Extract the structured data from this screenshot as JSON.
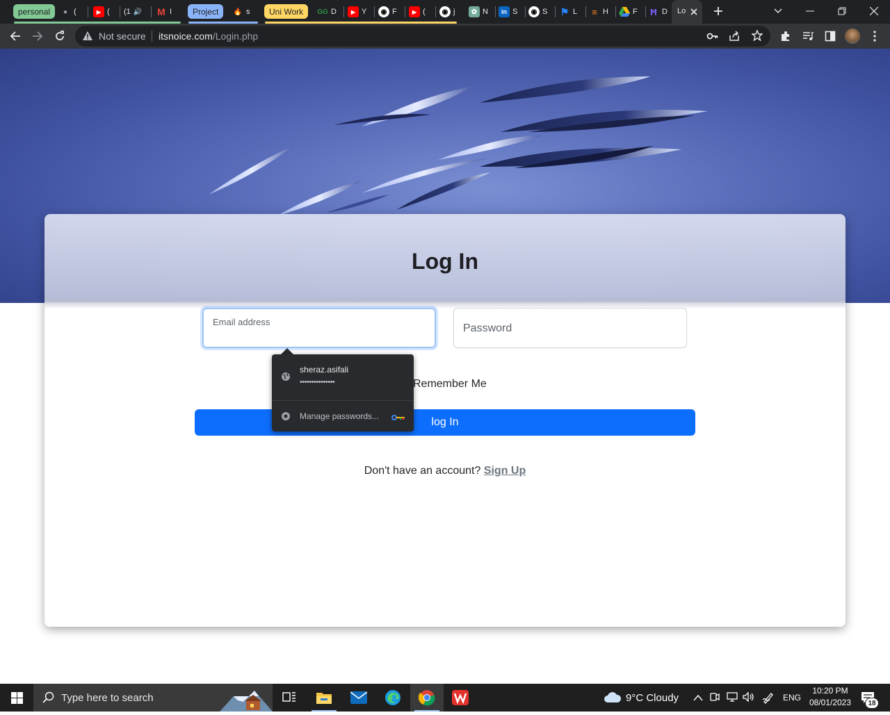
{
  "browser": {
    "tab_groups": [
      {
        "label": "personal",
        "color": "#81c995",
        "text_color": "#202124"
      },
      {
        "label": "Project",
        "color": "#8ab4f8",
        "text_color": "#202124"
      },
      {
        "label": "Uni Work",
        "color": "#fdd663",
        "text_color": "#202124"
      }
    ],
    "tabs": [
      {
        "title": "(",
        "icon": "generic"
      },
      {
        "title": "(",
        "icon": "youtube-icon"
      },
      {
        "title": "(1",
        "icon": "generic"
      },
      {
        "title": "I",
        "icon": "gmail-icon"
      },
      {
        "title": "s",
        "icon": "flame-icon"
      },
      {
        "title": "D",
        "icon": "geeks-icon"
      },
      {
        "title": "Y",
        "icon": "youtube-icon"
      },
      {
        "title": "F",
        "icon": "github-icon"
      },
      {
        "title": "(",
        "icon": "youtube-icon"
      },
      {
        "title": "j",
        "icon": "github-icon"
      },
      {
        "title": "N",
        "icon": "chatgpt-icon"
      },
      {
        "title": "S",
        "icon": "linkedin-icon"
      },
      {
        "title": "S",
        "icon": "github-icon"
      },
      {
        "title": "L",
        "icon": "bitbucket-icon"
      },
      {
        "title": "H",
        "icon": "stackoverflow-icon"
      },
      {
        "title": "F",
        "icon": "drive-icon"
      },
      {
        "title": "D",
        "icon": "h-icon"
      }
    ],
    "active_tab": {
      "title": "Lo"
    },
    "omnibox": {
      "security_label": "Not secure",
      "url_domain": "itsnoice.com",
      "url_path": "/Login.php"
    }
  },
  "page": {
    "title": "Log In",
    "email_label": "Email address",
    "password_label": "Password",
    "remember_label": "Remember Me",
    "login_button": "log In",
    "signup_prompt": "Don't have an account?",
    "signup_link": "Sign Up"
  },
  "password_popup": {
    "username": "sheraz.asifali",
    "password_mask": "•••••••••••••••",
    "manage_label": "Manage passwords..."
  },
  "taskbar": {
    "search_placeholder": "Type here to search",
    "weather": "9°C  Cloudy",
    "language": "ENG",
    "time": "10:20 PM",
    "date": "08/01/2023",
    "notification_count": "18"
  },
  "colors": {
    "primary_button": "#0d6efd",
    "hero_blue": "#5a6ebb"
  }
}
